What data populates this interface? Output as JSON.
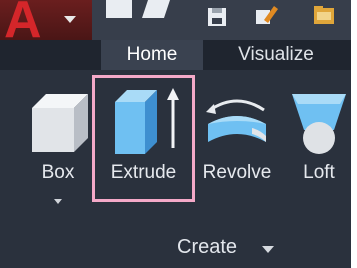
{
  "colors": {
    "ribbon_bg": "#2a313d",
    "tab_bg": "#1f252f",
    "active_tab_bg": "#3a4250",
    "highlight": "#f4a9c8",
    "app_red": "#d4262a"
  },
  "app_button": {
    "glyph": "A",
    "icon": "autocad-logo-icon"
  },
  "quick_access": [
    {
      "icon": "save-icon"
    },
    {
      "icon": "edit-icon"
    },
    {
      "icon": "open-icon"
    }
  ],
  "tabs": [
    {
      "label": "Home",
      "active": true
    },
    {
      "label": "Visualize",
      "active": false
    }
  ],
  "tools": [
    {
      "label": "Box",
      "icon": "box-icon",
      "has_dropdown": true
    },
    {
      "label": "Extrude",
      "icon": "extrude-icon",
      "selected": true
    },
    {
      "label": "Revolve",
      "icon": "revolve-icon"
    },
    {
      "label": "Loft",
      "icon": "loft-icon"
    }
  ],
  "panel": {
    "title": "Create",
    "has_dropdown": true
  }
}
